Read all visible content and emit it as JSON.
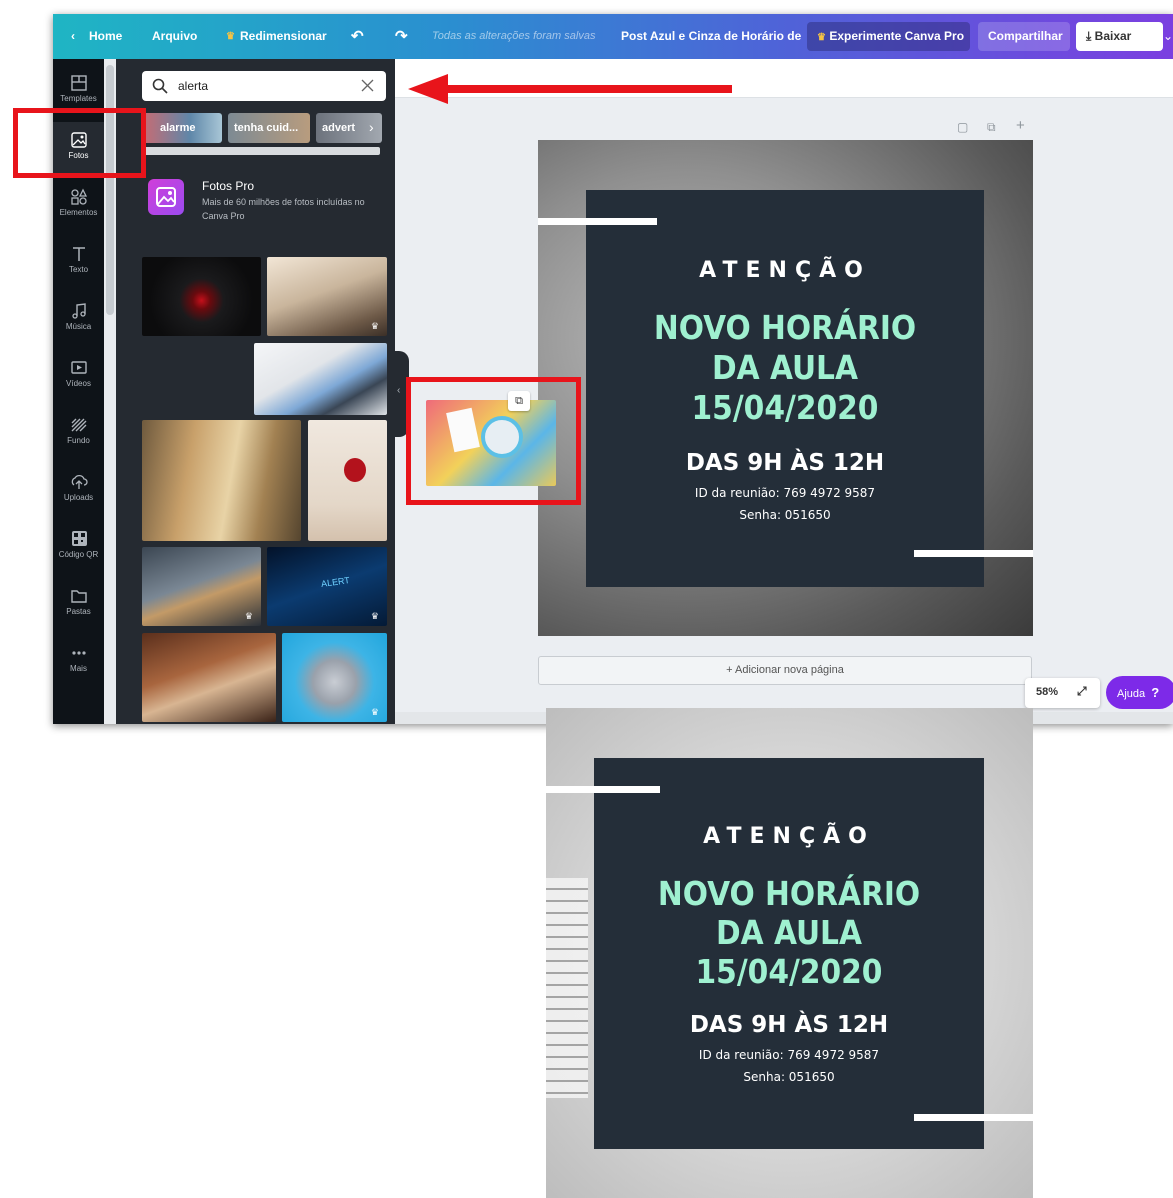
{
  "topbar": {
    "home": "Home",
    "file": "Arquivo",
    "resize": "Redimensionar",
    "saved": "Todas as alterações foram salvas",
    "doc_title": "Post Azul e Cinza de Horário de",
    "try_pro": "Experimente Canva Pro",
    "share": "Compartilhar",
    "download": "Baixar"
  },
  "sidebar": {
    "items": [
      {
        "label": "Templates",
        "icon": "template-icon"
      },
      {
        "label": "Fotos",
        "icon": "photo-icon"
      },
      {
        "label": "Elementos",
        "icon": "elements-icon"
      },
      {
        "label": "Texto",
        "icon": "text-icon"
      },
      {
        "label": "Música",
        "icon": "music-icon"
      },
      {
        "label": "Vídeos",
        "icon": "video-icon"
      },
      {
        "label": "Fundo",
        "icon": "background-icon"
      },
      {
        "label": "Uploads",
        "icon": "upload-icon"
      },
      {
        "label": "Código QR",
        "icon": "qr-code-icon"
      },
      {
        "label": "Pastas",
        "icon": "folder-icon"
      },
      {
        "label": "Mais",
        "icon": "more-icon"
      }
    ]
  },
  "panel": {
    "search_value": "alerta",
    "chips": [
      "alarme",
      "tenha cuid...",
      "advert"
    ],
    "pro_title": "Fotos Pro",
    "pro_desc": "Mais de 60 milhões de fotos incluídas no Canva Pro",
    "alert_text": "ALERT"
  },
  "canvas": {
    "add_page": "+ Adicionar nova página",
    "zoom": "58%",
    "help": "Ajuda",
    "help_mark": "?"
  },
  "design": {
    "attention": "ATENÇÃO",
    "new_schedule_lines": [
      "NOVO HORÁRIO",
      "DA AULA",
      "15/04/2020"
    ],
    "time": "DAS 9H ÀS 12H",
    "meeting_id": "ID da reunião: 769 4972 9587",
    "password": "Senha: 051650"
  },
  "colors": {
    "highlight": "#e8141b",
    "card": "#242e39",
    "headline": "#9ff0d0",
    "accent": "#7d2ae8"
  }
}
